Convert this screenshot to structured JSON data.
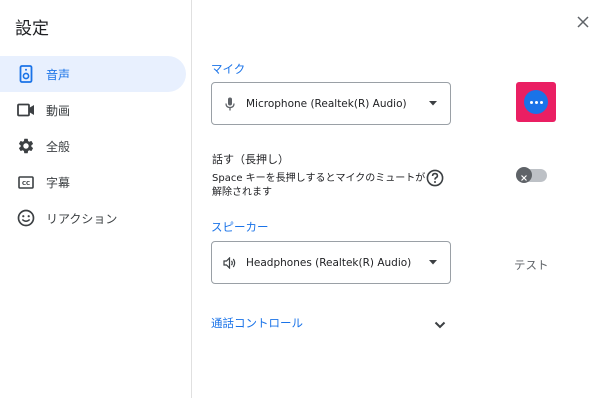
{
  "dialog": {
    "title": "設定"
  },
  "sidebar": {
    "items": [
      {
        "label": "音声",
        "icon": "speaker-icon",
        "active": true
      },
      {
        "label": "動画",
        "icon": "video-camera-icon",
        "active": false
      },
      {
        "label": "全般",
        "icon": "gear-icon",
        "active": false
      },
      {
        "label": "字幕",
        "icon": "closed-captions-icon",
        "active": false
      },
      {
        "label": "リアクション",
        "icon": "smiley-icon",
        "active": false
      }
    ]
  },
  "audio": {
    "mic_section_label": "マイク",
    "mic_device": "Microphone (Realtek(R) Audio)",
    "push_to_talk": {
      "title": "話す（長押し）",
      "description": "Space キーを長押しするとマイクのミュートが解除されます",
      "enabled": false
    },
    "speaker_section_label": "スピーカー",
    "speaker_device": "Headphones (Realtek(R) Audio)",
    "test_label": "テスト",
    "call_controls_label": "通話コントロール"
  },
  "colors": {
    "accent": "#1a73e8",
    "highlight": "#ea1f63",
    "active_nav_bg": "#e8f0fe"
  }
}
